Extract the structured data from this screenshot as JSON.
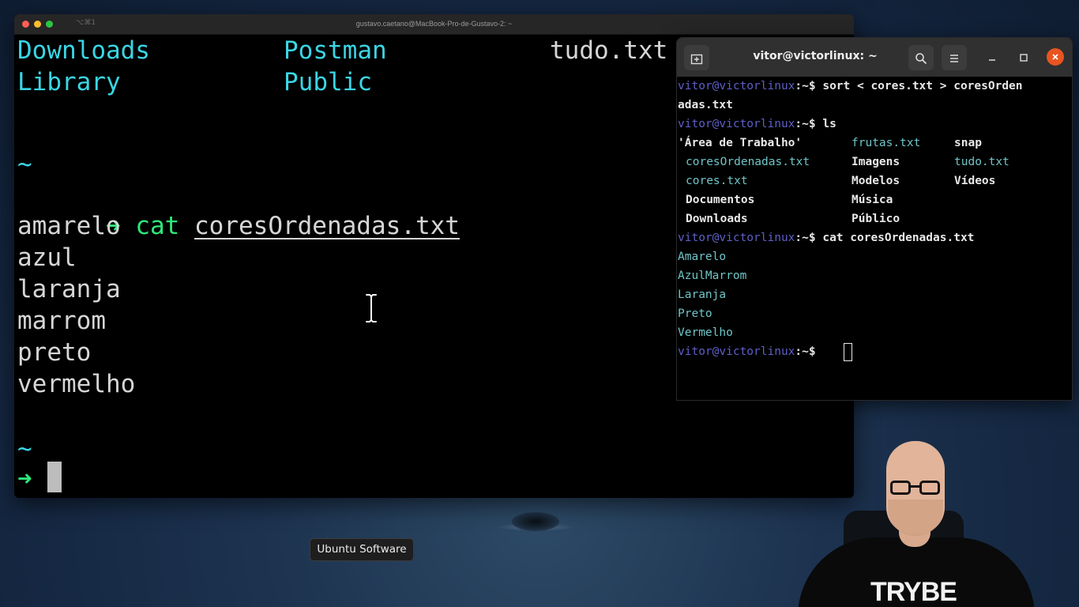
{
  "mac_terminal": {
    "title": "gustavo.caetano@MacBook-Pro-de-Gustavo-2: ~",
    "shortcut": "⌥⌘1",
    "ls_row1": [
      "Downloads",
      "Postman",
      "tudo.txt"
    ],
    "ls_row2": [
      "Library",
      "Public"
    ],
    "tilde": "~",
    "arrow": "➜",
    "cmd_name": "cat",
    "cmd_arg": "coresOrdenadas.txt",
    "output": [
      "amarelo",
      "azul",
      "laranja",
      "marrom",
      "preto",
      "vermelho"
    ]
  },
  "ubuntu_terminal": {
    "title": "vitor@victorlinux: ~",
    "prompt_user": "vitor@victorlinux",
    "prompt_tilde": ":~",
    "prompt_dollar": "$",
    "cmd1": "sort < cores.txt > coresOrdenadas.txt",
    "cmd1_line1": "sort < cores.txt > coresOrden",
    "cmd1_line2": "adas.txt",
    "cmd2": "ls",
    "ls_items": [
      {
        "name": "'Área de Trabalho'",
        "kind": "dir"
      },
      {
        "name": "frutas.txt",
        "kind": "file"
      },
      {
        "name": "snap",
        "kind": "dir"
      },
      {
        "name": "coresOrdenadas.txt",
        "kind": "file"
      },
      {
        "name": "Imagens",
        "kind": "dir"
      },
      {
        "name": "tudo.txt",
        "kind": "file"
      },
      {
        "name": "cores.txt",
        "kind": "file"
      },
      {
        "name": "Modelos",
        "kind": "dir"
      },
      {
        "name": "Vídeos",
        "kind": "dir"
      },
      {
        "name": "Documentos",
        "kind": "dir"
      },
      {
        "name": "Música",
        "kind": "dir"
      },
      {
        "name": "Downloads",
        "kind": "dir"
      },
      {
        "name": "Público",
        "kind": "dir"
      }
    ],
    "cmd3": "cat coresOrdenadas.txt",
    "cat_output": [
      "Amarelo",
      "AzulMarrom",
      "Laranja",
      "Preto",
      "Vermelho"
    ],
    "icons": {
      "new_tab": "new-tab-icon",
      "search": "search-icon",
      "menu": "hamburger-menu-icon",
      "minimize": "minimize-icon",
      "maximize": "maximize-icon",
      "close": "close-icon"
    }
  },
  "dock_tooltip": "Ubuntu Software",
  "presenter": {
    "shirt_text": "TRYBE"
  },
  "colors": {
    "mac_cyan": "#3ad6e6",
    "mac_green": "#2ee87a",
    "ubuntu_prompt": "#5f5fc8",
    "ubuntu_file": "#6fc5c8",
    "ubuntu_close": "#e95420"
  }
}
